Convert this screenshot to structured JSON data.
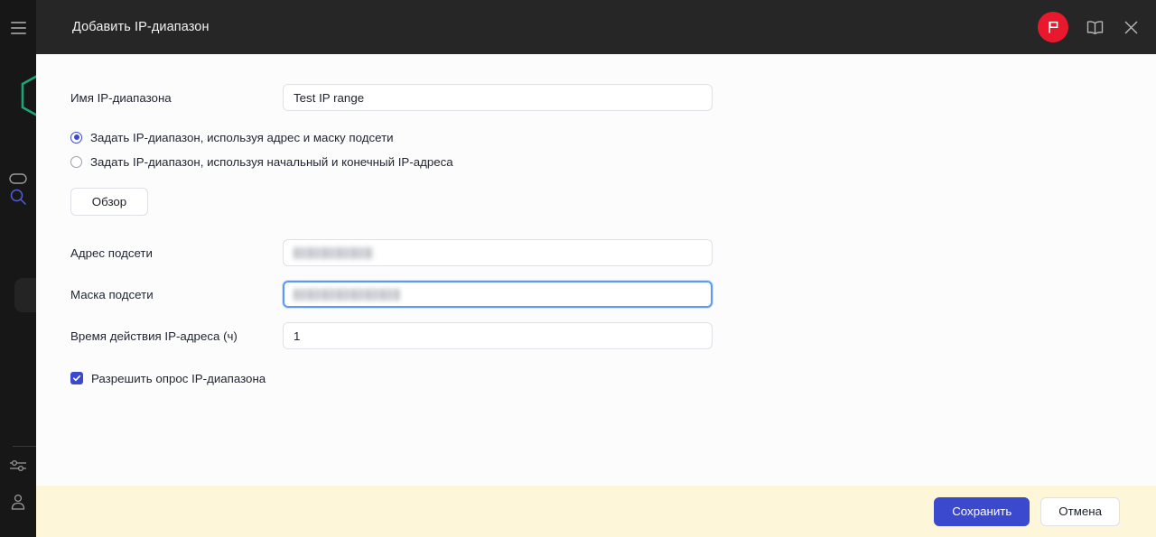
{
  "window": {
    "title": "Добавить IP-диапазон",
    "actions": [
      {
        "name": "flag-button",
        "icon": "flag-icon"
      },
      {
        "name": "manual-button",
        "icon": "book-icon"
      },
      {
        "name": "close-button",
        "icon": "close-icon"
      }
    ]
  },
  "sidebar": {
    "menu_icon": "hamburger-icon",
    "logo": "hexagon-logo",
    "items": [
      {
        "icon": "capsule-icon"
      },
      {
        "icon": "search-icon"
      },
      {
        "icon": "sliders-icon"
      },
      {
        "icon": "user-icon"
      }
    ]
  },
  "form": {
    "name_label": "Имя IP-диапазона",
    "name_value": "Test IP range",
    "name_placeholder": "",
    "radio_subnet_mask": "Задать IP-диапазон, используя адрес и маску подсети",
    "radio_start_end": "Задать IP-диапазон, используя начальный и конечный IP-адреса",
    "browse_button": "Обзор",
    "subnet_address_label": "Адрес подсети",
    "subnet_address_value": "",
    "subnet_mask_label": "Маска подсети",
    "subnet_mask_value": "",
    "lease_time_label": "Время действия IP-адреса (ч)",
    "lease_time_value": "1",
    "allow_scan_label": "Разрешить опрос IP-диапазона"
  },
  "footer": {
    "save_label": "Сохранить",
    "cancel_label": "Отмена"
  },
  "colors": {
    "accent": "#3b49cf",
    "flag": "#e8192c",
    "logo": "#1fa37a",
    "focus_ring": "#5b9bf8",
    "footer_bg": "#fdf6d8",
    "titlebar_bg": "#262626",
    "rail_bg": "#171717"
  }
}
